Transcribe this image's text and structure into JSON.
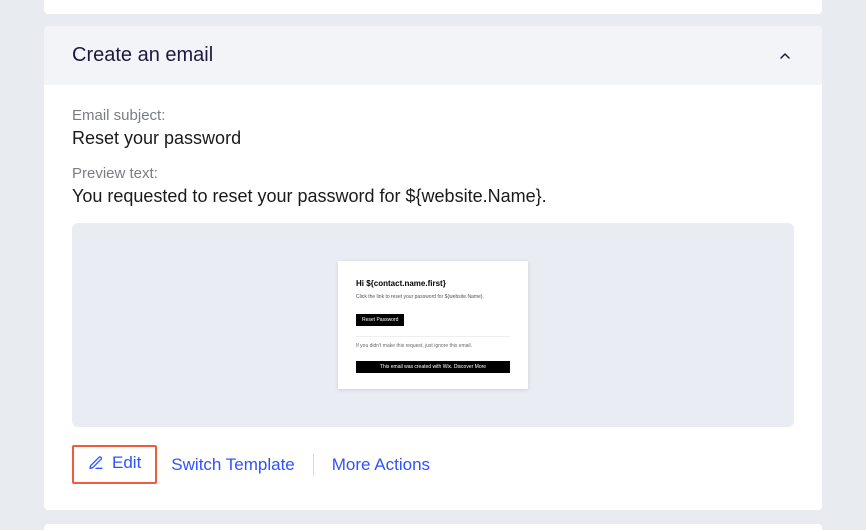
{
  "header": {
    "title": "Create an email"
  },
  "subject": {
    "label": "Email subject:",
    "value": "Reset your password"
  },
  "preview": {
    "label": "Preview text:",
    "value": "You requested to reset your password for ${website.Name}."
  },
  "thumb": {
    "greeting": "Hi ${contact.name.first}",
    "line1": "Click the link to reset your password for ${website.Name}.",
    "button": "Reset Password",
    "line2": "If you didn't make this request, just ignore this email.",
    "footer": "This email was created with Wix.   Discover More"
  },
  "actions": {
    "edit": "Edit",
    "switch": "Switch Template",
    "more": "More Actions"
  }
}
